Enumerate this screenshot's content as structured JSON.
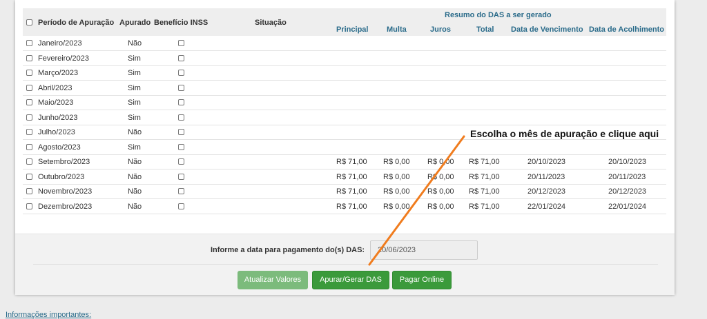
{
  "table": {
    "headers": {
      "periodo": "Período de Apuração",
      "apurado": "Apurado",
      "beneficio": "Benefício INSS",
      "situacao": "Situação",
      "resumo": "Resumo do DAS a ser gerado",
      "principal": "Principal",
      "multa": "Multa",
      "juros": "Juros",
      "total": "Total",
      "vencimento": "Data de Vencimento",
      "acolhimento": "Data de Acolhimento"
    },
    "rows": [
      {
        "mes": "Janeiro/2023",
        "apurado": "Não",
        "principal": "",
        "multa": "",
        "juros": "",
        "total": "",
        "vencimento": "",
        "acolhimento": ""
      },
      {
        "mes": "Fevereiro/2023",
        "apurado": "Sim",
        "principal": "",
        "multa": "",
        "juros": "",
        "total": "",
        "vencimento": "",
        "acolhimento": ""
      },
      {
        "mes": "Março/2023",
        "apurado": "Sim",
        "principal": "",
        "multa": "",
        "juros": "",
        "total": "",
        "vencimento": "",
        "acolhimento": ""
      },
      {
        "mes": "Abril/2023",
        "apurado": "Sim",
        "principal": "",
        "multa": "",
        "juros": "",
        "total": "",
        "vencimento": "",
        "acolhimento": ""
      },
      {
        "mes": "Maio/2023",
        "apurado": "Sim",
        "principal": "",
        "multa": "",
        "juros": "",
        "total": "",
        "vencimento": "",
        "acolhimento": ""
      },
      {
        "mes": "Junho/2023",
        "apurado": "Sim",
        "principal": "",
        "multa": "",
        "juros": "",
        "total": "",
        "vencimento": "",
        "acolhimento": ""
      },
      {
        "mes": "Julho/2023",
        "apurado": "Não",
        "principal": "",
        "multa": "",
        "juros": "",
        "total": "",
        "vencimento": "",
        "acolhimento": ""
      },
      {
        "mes": "Agosto/2023",
        "apurado": "Sim",
        "principal": "",
        "multa": "",
        "juros": "",
        "total": "",
        "vencimento": "",
        "acolhimento": ""
      },
      {
        "mes": "Setembro/2023",
        "apurado": "Não",
        "principal": "R$ 71,00",
        "multa": "R$ 0,00",
        "juros": "R$ 0,00",
        "total": "R$ 71,00",
        "vencimento": "20/10/2023",
        "acolhimento": "20/10/2023"
      },
      {
        "mes": "Outubro/2023",
        "apurado": "Não",
        "principal": "R$ 71,00",
        "multa": "R$ 0,00",
        "juros": "R$ 0,00",
        "total": "R$ 71,00",
        "vencimento": "20/11/2023",
        "acolhimento": "20/11/2023"
      },
      {
        "mes": "Novembro/2023",
        "apurado": "Não",
        "principal": "R$ 71,00",
        "multa": "R$ 0,00",
        "juros": "R$ 0,00",
        "total": "R$ 71,00",
        "vencimento": "20/12/2023",
        "acolhimento": "20/12/2023"
      },
      {
        "mes": "Dezembro/2023",
        "apurado": "Não",
        "principal": "R$ 71,00",
        "multa": "R$ 0,00",
        "juros": "R$ 0,00",
        "total": "R$ 71,00",
        "vencimento": "22/01/2024",
        "acolhimento": "22/01/2024"
      }
    ]
  },
  "footer": {
    "date_label": "Informe a data para pagamento do(s) DAS:",
    "date_value": "20/06/2023",
    "buttons": {
      "atualizar": "Atualizar Valores",
      "gerar": "Apurar/Gerar DAS",
      "pagar": "Pagar Online"
    }
  },
  "annotation": {
    "text": "Escolha o mês de apuração e clique aqui",
    "color": "#f07c1e"
  },
  "info_link": "Informações importantes:",
  "colors": {
    "header_teal": "#2a6b8a",
    "button_green": "#3b9a3b",
    "button_disabled": "#7cbb7c"
  }
}
